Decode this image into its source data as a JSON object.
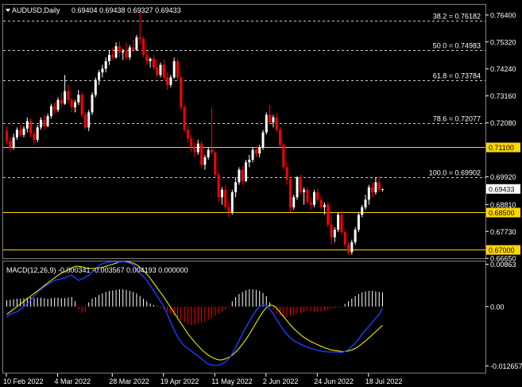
{
  "main_header": {
    "symbol_label": "AUDUSD,Daily",
    "ohlc": "0.69404 0.69438 0.69327 0.69433"
  },
  "macd_header": {
    "label": "MACD(12,26,9) -0.000341 -0.003567 0.004193 0.000000"
  },
  "colors": {
    "background": "#000000",
    "bull_candle": "#ffffff",
    "bear_candle": "#ff0000",
    "fib_line": "#c8c8c8",
    "horizontal_level": "#ffd700",
    "macd_signal": "#ffff00",
    "macd_main": "#1e3cff",
    "histogram_pos": "#ffffff",
    "histogram_neg": "#ff0000",
    "axis_text": "#ffffff"
  },
  "chart_data": [
    {
      "type": "candlestick",
      "title": "AUDUSD,Daily",
      "ylim": [
        0.66656,
        0.7681
      ],
      "price_ticks": [
        "0.76400",
        "0.75320",
        "0.74240",
        "0.73160",
        "0.72080",
        "0.69920",
        "0.68810",
        "0.67730",
        "0.66650"
      ],
      "current_price_label": "0.69433",
      "horizontal_levels": [
        {
          "label": "0.71100",
          "value": 0.711
        },
        {
          "label": "0.68500",
          "value": 0.685
        },
        {
          "label": "0.67000",
          "value": 0.67
        }
      ],
      "fibonacci_levels": [
        {
          "label": "38.2 = 0.76182",
          "value": 0.76182
        },
        {
          "label": "50.0 = 0.74983",
          "value": 0.74983
        },
        {
          "label": "61.8 = 0.73784",
          "value": 0.73784
        },
        {
          "label": "78.6 = 0.72077",
          "value": 0.72077
        },
        {
          "label": "100.0 = 0.69902",
          "value": 0.69902
        }
      ],
      "candles_ohlc": [
        [
          0.7175,
          0.7195,
          0.712,
          0.7135
        ],
        [
          0.7135,
          0.715,
          0.7095,
          0.711
        ],
        [
          0.711,
          0.7165,
          0.71,
          0.715
        ],
        [
          0.715,
          0.719,
          0.714,
          0.718
        ],
        [
          0.718,
          0.72,
          0.715,
          0.716
        ],
        [
          0.716,
          0.7195,
          0.715,
          0.7185
        ],
        [
          0.7185,
          0.723,
          0.717,
          0.7215
        ],
        [
          0.7215,
          0.7225,
          0.715,
          0.7165
        ],
        [
          0.7165,
          0.718,
          0.712,
          0.714
        ],
        [
          0.714,
          0.72,
          0.713,
          0.719
        ],
        [
          0.719,
          0.723,
          0.718,
          0.722
        ],
        [
          0.722,
          0.724,
          0.718,
          0.7195
        ],
        [
          0.7195,
          0.7245,
          0.719,
          0.7235
        ],
        [
          0.7235,
          0.7285,
          0.7225,
          0.7275
        ],
        [
          0.7275,
          0.729,
          0.7245,
          0.726
        ],
        [
          0.726,
          0.731,
          0.725,
          0.73
        ],
        [
          0.73,
          0.733,
          0.727,
          0.7285
        ],
        [
          0.7285,
          0.74,
          0.728,
          0.7335
        ],
        [
          0.7335,
          0.736,
          0.7285,
          0.73
        ],
        [
          0.73,
          0.731,
          0.725,
          0.727
        ],
        [
          0.727,
          0.73,
          0.725,
          0.729
        ],
        [
          0.729,
          0.734,
          0.728,
          0.732
        ],
        [
          0.732,
          0.733,
          0.723,
          0.724
        ],
        [
          0.724,
          0.725,
          0.718,
          0.719
        ],
        [
          0.719,
          0.726,
          0.7175,
          0.725
        ],
        [
          0.725,
          0.733,
          0.724,
          0.732
        ],
        [
          0.732,
          0.739,
          0.731,
          0.738
        ],
        [
          0.738,
          0.742,
          0.736,
          0.741
        ],
        [
          0.741,
          0.744,
          0.739,
          0.7425
        ],
        [
          0.7425,
          0.747,
          0.741,
          0.7455
        ],
        [
          0.7455,
          0.75,
          0.744,
          0.748
        ],
        [
          0.748,
          0.751,
          0.746,
          0.747
        ],
        [
          0.747,
          0.753,
          0.7465,
          0.7515
        ],
        [
          0.7515,
          0.7535,
          0.747,
          0.749
        ],
        [
          0.749,
          0.7505,
          0.746,
          0.7495
        ],
        [
          0.7495,
          0.753,
          0.746,
          0.747
        ],
        [
          0.747,
          0.752,
          0.746,
          0.751
        ],
        [
          0.751,
          0.754,
          0.749,
          0.75
        ],
        [
          0.75,
          0.756,
          0.7495,
          0.755
        ],
        [
          0.755,
          0.766,
          0.752,
          0.7545
        ],
        [
          0.7545,
          0.7555,
          0.747,
          0.748
        ],
        [
          0.748,
          0.7495,
          0.744,
          0.7455
        ],
        [
          0.7455,
          0.747,
          0.743,
          0.7465
        ],
        [
          0.7465,
          0.748,
          0.742,
          0.743
        ],
        [
          0.743,
          0.746,
          0.739,
          0.74
        ],
        [
          0.74,
          0.745,
          0.739,
          0.744
        ],
        [
          0.744,
          0.746,
          0.738,
          0.739
        ],
        [
          0.739,
          0.741,
          0.734,
          0.736
        ],
        [
          0.736,
          0.74,
          0.735,
          0.739
        ],
        [
          0.739,
          0.747,
          0.7385,
          0.7455
        ],
        [
          0.7455,
          0.7465,
          0.738,
          0.739
        ],
        [
          0.739,
          0.7395,
          0.726,
          0.727
        ],
        [
          0.727,
          0.728,
          0.717,
          0.718
        ],
        [
          0.718,
          0.72,
          0.713,
          0.7145
        ],
        [
          0.7145,
          0.716,
          0.709,
          0.711
        ],
        [
          0.711,
          0.713,
          0.707,
          0.709
        ],
        [
          0.709,
          0.714,
          0.708,
          0.7125
        ],
        [
          0.7125,
          0.7135,
          0.703,
          0.704
        ],
        [
          0.704,
          0.708,
          0.702,
          0.707
        ],
        [
          0.707,
          0.711,
          0.706,
          0.71
        ],
        [
          0.71,
          0.727,
          0.708,
          0.709
        ],
        [
          0.709,
          0.7095,
          0.699,
          0.7
        ],
        [
          0.7,
          0.701,
          0.689,
          0.691
        ],
        [
          0.691,
          0.695,
          0.688,
          0.694
        ],
        [
          0.694,
          0.696,
          0.686,
          0.687
        ],
        [
          0.687,
          0.689,
          0.683,
          0.685
        ],
        [
          0.685,
          0.694,
          0.684,
          0.693
        ],
        [
          0.693,
          0.699,
          0.691,
          0.697
        ],
        [
          0.697,
          0.703,
          0.696,
          0.702
        ],
        [
          0.702,
          0.7035,
          0.696,
          0.6975
        ],
        [
          0.6975,
          0.706,
          0.697,
          0.705
        ],
        [
          0.705,
          0.708,
          0.703,
          0.706
        ],
        [
          0.706,
          0.711,
          0.705,
          0.71
        ],
        [
          0.71,
          0.7115,
          0.707,
          0.7085
        ],
        [
          0.7085,
          0.712,
          0.707,
          0.711
        ],
        [
          0.711,
          0.718,
          0.71,
          0.717
        ],
        [
          0.717,
          0.725,
          0.716,
          0.724
        ],
        [
          0.724,
          0.728,
          0.72,
          0.721
        ],
        [
          0.721,
          0.724,
          0.719,
          0.723
        ],
        [
          0.723,
          0.7245,
          0.717,
          0.718
        ],
        [
          0.718,
          0.719,
          0.711,
          0.712
        ],
        [
          0.712,
          0.713,
          0.702,
          0.703
        ],
        [
          0.703,
          0.705,
          0.696,
          0.698
        ],
        [
          0.698,
          0.699,
          0.685,
          0.687
        ],
        [
          0.687,
          0.692,
          0.686,
          0.691
        ],
        [
          0.691,
          0.6995,
          0.69,
          0.699
        ],
        [
          0.699,
          0.7,
          0.692,
          0.693
        ],
        [
          0.693,
          0.695,
          0.688,
          0.694
        ],
        [
          0.694,
          0.695,
          0.688,
          0.689
        ],
        [
          0.689,
          0.691,
          0.686,
          0.688
        ],
        [
          0.688,
          0.694,
          0.687,
          0.693
        ],
        [
          0.693,
          0.6945,
          0.689,
          0.69
        ],
        [
          0.69,
          0.6915,
          0.686,
          0.687
        ],
        [
          0.687,
          0.689,
          0.684,
          0.688
        ],
        [
          0.688,
          0.689,
          0.679,
          0.68
        ],
        [
          0.68,
          0.684,
          0.672,
          0.675
        ],
        [
          0.675,
          0.679,
          0.673,
          0.678
        ],
        [
          0.678,
          0.685,
          0.677,
          0.684
        ],
        [
          0.684,
          0.6855,
          0.676,
          0.677
        ],
        [
          0.677,
          0.678,
          0.671,
          0.672
        ],
        [
          0.672,
          0.673,
          0.668,
          0.669
        ],
        [
          0.669,
          0.674,
          0.668,
          0.673
        ],
        [
          0.673,
          0.679,
          0.672,
          0.678
        ],
        [
          0.678,
          0.685,
          0.677,
          0.684
        ],
        [
          0.684,
          0.688,
          0.683,
          0.687
        ],
        [
          0.687,
          0.692,
          0.686,
          0.69
        ],
        [
          0.69,
          0.696,
          0.688,
          0.695
        ],
        [
          0.695,
          0.697,
          0.691,
          0.693
        ],
        [
          0.693,
          0.699,
          0.692,
          0.697
        ],
        [
          0.697,
          0.6995,
          0.693,
          0.694
        ],
        [
          0.69404,
          0.69438,
          0.69327,
          0.69433
        ]
      ]
    },
    {
      "type": "macd",
      "title": "MACD(12,26,9) -0.000341 -0.003567 0.004193 0.000000",
      "ylim": [
        -0.012657,
        0.00863
      ],
      "tick_labels": [
        "0.00863",
        "0.00",
        "-0.012657"
      ],
      "histogram": [
        0.0012,
        0.0013,
        0.0014,
        0.0015,
        0.0015,
        0.0016,
        0.0017,
        0.0018,
        0.0016,
        0.0017,
        0.0017,
        0.0016,
        0.0015,
        0.0016,
        0.0017,
        0.0017,
        0.0016,
        0.0016,
        0.0017,
        0.0018,
        0.001,
        -0.0005,
        -0.0012,
        -0.001,
        0.0008,
        0.0015,
        0.0018,
        0.0022,
        0.0025,
        0.0028,
        0.003,
        0.0031,
        0.0032,
        0.0033,
        0.0033,
        0.0032,
        0.003,
        0.0028,
        0.0025,
        0.002,
        0.0015,
        0.001,
        0.0006,
        0.0003,
        0.0001,
        -0.0003,
        -0.0006,
        -0.001,
        -0.0014,
        -0.0018,
        -0.0022,
        -0.0026,
        -0.003,
        -0.0034,
        -0.0036,
        -0.0034,
        -0.0032,
        -0.003,
        -0.0028,
        -0.0025,
        -0.0022,
        -0.0018,
        -0.0014,
        -0.001,
        -0.0006,
        -0.0002,
        0.001,
        0.0018,
        0.0024,
        0.0028,
        0.0031,
        0.0033,
        0.0033,
        0.0032,
        0.003,
        0.0026,
        0.002,
        0.0008,
        -0.0006,
        -0.0014,
        -0.0018,
        -0.002,
        -0.002,
        -0.0018,
        -0.0016,
        -0.0014,
        -0.0012,
        -0.001,
        -0.0008,
        -0.0009,
        -0.001,
        -0.0011,
        -0.001,
        -0.0008,
        -0.0006,
        -0.0004,
        -0.0003,
        -0.0002,
        -0.0001,
        0.0005,
        0.001,
        0.0015,
        0.002,
        0.0024,
        0.0027,
        0.0029,
        0.003,
        0.003,
        0.0029,
        0.0028,
        0.0027
      ],
      "signal_line": [
        -0.0015,
        -0.001,
        -0.0005,
        0.0,
        0.0005,
        0.001,
        0.0015,
        0.002,
        0.0025,
        0.003,
        0.0035,
        0.004,
        0.0045,
        0.005,
        0.0055,
        0.006,
        0.0064,
        0.0067,
        0.007,
        0.0074,
        0.0077,
        0.0077,
        0.0076,
        0.0074,
        0.0073,
        0.0073,
        0.0073,
        0.0074,
        0.0075,
        0.0077,
        0.0079,
        0.0081,
        0.0083,
        0.0085,
        0.0086,
        0.0086,
        0.0085,
        0.0083,
        0.008,
        0.0075,
        0.0069,
        0.0062,
        0.0054,
        0.0045,
        0.0036,
        0.0027,
        0.0018,
        0.0008,
        -0.0002,
        -0.0012,
        -0.0022,
        -0.0032,
        -0.0042,
        -0.0052,
        -0.006,
        -0.0068,
        -0.0075,
        -0.0082,
        -0.0088,
        -0.0093,
        -0.0097,
        -0.01,
        -0.0102,
        -0.0102,
        -0.01,
        -0.0097,
        -0.0093,
        -0.0087,
        -0.008,
        -0.0072,
        -0.0063,
        -0.0053,
        -0.0042,
        -0.0031,
        -0.002,
        -0.001,
        -0.0002,
        0.0003,
        0.0002,
        -0.0003,
        -0.0011,
        -0.0019,
        -0.0027,
        -0.0035,
        -0.0042,
        -0.0048,
        -0.0054,
        -0.0059,
        -0.0063,
        -0.0067,
        -0.007,
        -0.0073,
        -0.0076,
        -0.0079,
        -0.0081,
        -0.0083,
        -0.0084,
        -0.0085,
        -0.0086,
        -0.0086,
        -0.0085,
        -0.0083,
        -0.008,
        -0.0076,
        -0.0071,
        -0.0066,
        -0.006,
        -0.0054,
        -0.0048,
        -0.0042,
        -0.0036
      ],
      "macd_line": [
        -0.002,
        -0.0015,
        -0.0012,
        -0.001,
        -0.0005,
        0.0,
        0.0005,
        0.0012,
        0.002,
        0.0027,
        0.0033,
        0.0038,
        0.0042,
        0.0046,
        0.005,
        0.0052,
        0.0053,
        0.0055,
        0.0058,
        0.006,
        0.0055,
        0.005,
        0.0053,
        0.0056,
        0.006,
        0.0066,
        0.0072,
        0.0078,
        0.0082,
        0.0084,
        0.0085,
        0.0086,
        0.0085,
        0.0085,
        0.0086,
        0.0085,
        0.0083,
        0.008,
        0.0072,
        0.0064,
        0.0057,
        0.005,
        0.004,
        0.003,
        0.002,
        0.001,
        0.0,
        -0.0015,
        -0.003,
        -0.0045,
        -0.0058,
        -0.0068,
        -0.0075,
        -0.008,
        -0.0085,
        -0.009,
        -0.0095,
        -0.01,
        -0.0105,
        -0.011,
        -0.0112,
        -0.0113,
        -0.0112,
        -0.011,
        -0.0106,
        -0.01,
        -0.009,
        -0.0078,
        -0.0065,
        -0.0052,
        -0.004,
        -0.0028,
        -0.0017,
        -0.0007,
        0.0,
        0.0003,
        0.0002,
        -0.0005,
        -0.0014,
        -0.0025,
        -0.0035,
        -0.0045,
        -0.0053,
        -0.006,
        -0.0065,
        -0.0069,
        -0.0072,
        -0.0075,
        -0.0078,
        -0.008,
        -0.0082,
        -0.0084,
        -0.0085,
        -0.0086,
        -0.0087,
        -0.0087,
        -0.0087,
        -0.0087,
        -0.0088,
        -0.0086,
        -0.0082,
        -0.0076,
        -0.007,
        -0.0062,
        -0.0053,
        -0.0045,
        -0.0038,
        -0.003,
        -0.0022,
        -0.0015,
        -0.0003
      ]
    }
  ],
  "x_axis": {
    "date_labels": [
      "10 Feb 2022",
      "4 Mar 2022",
      "28 Mar 2022",
      "19 Apr 2022",
      "11 May 2022",
      "2 Jun 2022",
      "24 Jun 2022",
      "18 Jul 2022"
    ]
  }
}
